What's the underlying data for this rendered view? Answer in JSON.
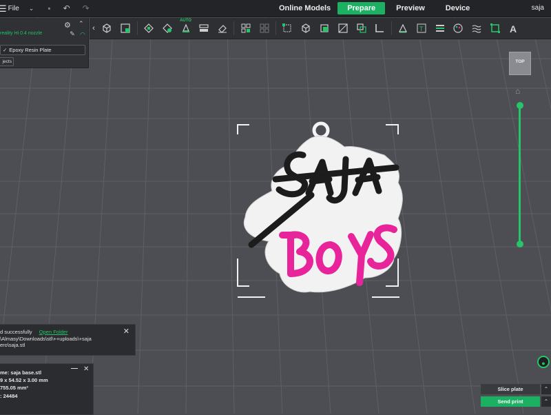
{
  "topbar": {
    "file_label": "File",
    "menu_icon": "hamburger-icon",
    "tabs": [
      {
        "label": "Online Models",
        "active": false
      },
      {
        "label": "Prepare",
        "active": true
      },
      {
        "label": "Preview",
        "active": false
      },
      {
        "label": "Device",
        "active": false
      }
    ],
    "user": "saja"
  },
  "toolbar": {
    "auto_badge": "AUTO",
    "tools": [
      "add-cube-icon",
      "grid-plate-icon",
      "arrange-icon",
      "orient-icon",
      "auto-orient-icon",
      "layout-icon",
      "eraser-icon",
      "split-objects-icon",
      "split-parts-icon",
      "scale-icon",
      "cube-view-icon",
      "cut-icon",
      "support-paint-icon",
      "boolean-icon",
      "measure-icon",
      "text-icon",
      "emboss-icon",
      "color-paint-icon",
      "seam-paint-icon",
      "fuzzy-skin-icon",
      "brim-icon",
      "assembly-text-icon"
    ]
  },
  "printer_panel": {
    "nozzle": "reality Hi 0.4 nozzle",
    "plate": "Epoxy Resin Plate",
    "objects_label": "jects"
  },
  "viewport": {
    "view_cube_label": "TOP",
    "model_text_top": "SAJA",
    "model_text_bottom": "BOYS"
  },
  "notice": {
    "line1": "d successfully",
    "open_folder": "Open Folder",
    "line2": "\\Almasy\\Downloads\\stl\\++uploads\\+saja",
    "line3": "ero\\saja.stl"
  },
  "info": {
    "name": "me: saja base.stl",
    "size": "9 x 54.52 x 3.00 mm",
    "volume": "755.05 mm³",
    "facets": ": 24484"
  },
  "actions": {
    "slice": "Slice plate",
    "print": "Send print"
  },
  "colors": {
    "accent": "#1bb062",
    "model_pink": "#e8249a",
    "model_black": "#1c1c1c"
  }
}
